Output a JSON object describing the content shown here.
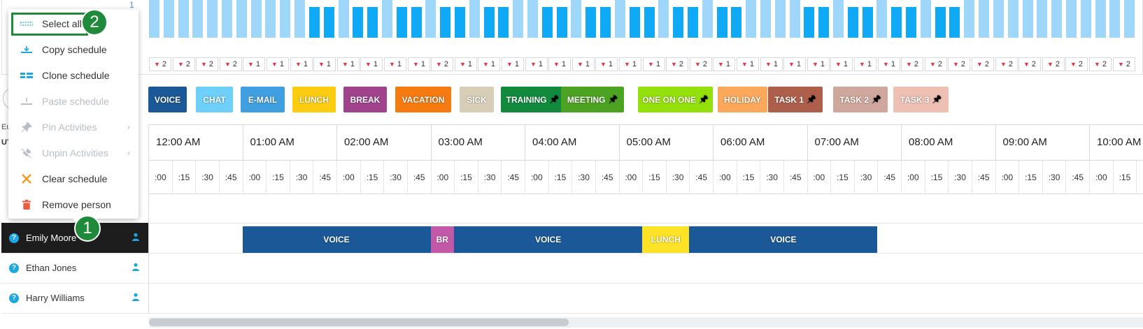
{
  "chart_axis_label": "1",
  "bar_colors": {
    "light": "#9fd7fb",
    "dark": "#10a9f5"
  },
  "bars": [
    "light",
    "light",
    "light",
    "light",
    "light",
    "light",
    "light",
    "light",
    "light",
    "light",
    "light",
    "dark",
    "dark",
    "light",
    "dark",
    "dark",
    "light",
    "dark",
    "dark",
    "light",
    "dark",
    "dark",
    "light",
    "dark",
    "dark",
    "light",
    "light",
    "dark",
    "dark",
    "light",
    "dark",
    "dark",
    "light",
    "dark",
    "dark",
    "light",
    "dark",
    "dark",
    "light",
    "dark",
    "dark",
    "light",
    "light",
    "light",
    "light",
    "dark",
    "dark",
    "light",
    "dark",
    "dark",
    "light",
    "dark",
    "dark",
    "light",
    "dark",
    "dark",
    "light",
    "light",
    "light",
    "light",
    "light",
    "light",
    "light",
    "light",
    "light",
    "light",
    "light",
    "light"
  ],
  "counters": [
    "2",
    "2",
    "2",
    "2",
    "1",
    "1",
    "1",
    "1",
    "1",
    "1",
    "1",
    "1",
    "2",
    "1",
    "1",
    "1",
    "1",
    "1",
    "1",
    "1",
    "1",
    "1",
    "2",
    "2",
    "1",
    "1",
    "1",
    "1",
    "1",
    "1",
    "1",
    "1",
    "2",
    "2",
    "2",
    "2",
    "2",
    "2",
    "2",
    "2",
    "2",
    "2"
  ],
  "legend": [
    {
      "label": "VOICE",
      "bg": "#1a5897",
      "fg": "#ffffff",
      "pin": false
    },
    {
      "label": "CHAT",
      "bg": "#6ed0f8",
      "fg": "#ffffff",
      "pin": false
    },
    {
      "label": "E-MAIL",
      "bg": "#3f9fe0",
      "fg": "#ffffff",
      "pin": false
    },
    {
      "label": "LUNCH",
      "bg": "#fccc11",
      "fg": "#ffffff",
      "pin": false
    },
    {
      "label": "BREAK",
      "bg": "#a1428d",
      "fg": "#ffffff",
      "pin": false
    },
    {
      "label": "VACATION",
      "bg": "#f57a10",
      "fg": "#ffffff",
      "pin": false
    },
    {
      "label": "SICK",
      "bg": "#d8ceb7",
      "fg": "#ffffff",
      "pin": false
    },
    {
      "label": "TRAINING",
      "bg": "#118a3e",
      "fg": "#ffffff",
      "pin": true
    },
    {
      "label": "MEETING",
      "bg": "#4ba321",
      "fg": "#ffffff",
      "pin": true
    },
    {
      "label": "ONE ON ONE",
      "bg": "#93e00a",
      "fg": "#ffffff",
      "pin": true
    },
    {
      "label": "HOLIDAY",
      "bg": "#fca85a",
      "fg": "#ffffff",
      "pin": false
    },
    {
      "label": "TASK 1",
      "bg": "#ad5f4b",
      "fg": "#ffffff",
      "pin": true
    },
    {
      "label": "TASK 2",
      "bg": "#cfa79c",
      "fg": "#ffffff",
      "pin": true
    },
    {
      "label": "TASK 3",
      "bg": "#eec0b4",
      "fg": "#ffffff",
      "pin": true
    }
  ],
  "left_info": {
    "line1": "Eu",
    "line2": "UT"
  },
  "hours": [
    "12:00 AM",
    "01:00 AM",
    "02:00 AM",
    "03:00 AM",
    "04:00 AM",
    "05:00 AM",
    "06:00 AM",
    "07:00 AM",
    "08:00 AM",
    "09:00 AM",
    "10:00 AM"
  ],
  "quarters": [
    ":00",
    ":15",
    ":30",
    ":45"
  ],
  "agents": [
    {
      "name": "",
      "selected": false,
      "visible": false
    },
    {
      "name": "Emily Moore",
      "selected": true,
      "visible": true
    },
    {
      "name": "Ethan Jones",
      "selected": false,
      "visible": true
    },
    {
      "name": "Harry Williams",
      "selected": false,
      "visible": true
    }
  ],
  "schedule": [
    {
      "label": "VOICE",
      "color": "#1a5897",
      "start_hour": 1.0,
      "end_hour": 3.0
    },
    {
      "label": "BR",
      "color": "#c358a9",
      "start_hour": 3.0,
      "end_hour": 3.25
    },
    {
      "label": "VOICE",
      "color": "#1a5897",
      "start_hour": 3.25,
      "end_hour": 5.25
    },
    {
      "label": "LUNCH",
      "color": "#fde226",
      "start_hour": 5.25,
      "end_hour": 5.75
    },
    {
      "label": "VOICE",
      "color": "#1a5897",
      "start_hour": 5.75,
      "end_hour": 7.75
    }
  ],
  "menu": [
    {
      "label": "Select all",
      "icon": "select-all-icon",
      "disabled": false,
      "submenu": false
    },
    {
      "label": "Copy schedule",
      "icon": "copy-schedule-icon",
      "disabled": false,
      "submenu": false
    },
    {
      "label": "Clone schedule",
      "icon": "clone-schedule-icon",
      "disabled": false,
      "submenu": false
    },
    {
      "label": "Paste schedule",
      "icon": "paste-schedule-icon",
      "disabled": true,
      "submenu": false
    },
    {
      "label": "Pin Activities",
      "icon": "pin-icon",
      "disabled": true,
      "submenu": true
    },
    {
      "label": "Unpin Activities",
      "icon": "unpin-icon",
      "disabled": true,
      "submenu": true
    },
    {
      "label": "Clear schedule",
      "icon": "clear-x-icon",
      "disabled": false,
      "submenu": false
    },
    {
      "label": "Remove person",
      "icon": "trash-icon",
      "disabled": false,
      "submenu": false
    }
  ],
  "badges": {
    "one": "1",
    "two": "2"
  },
  "badge_color": "#1e8a3a"
}
